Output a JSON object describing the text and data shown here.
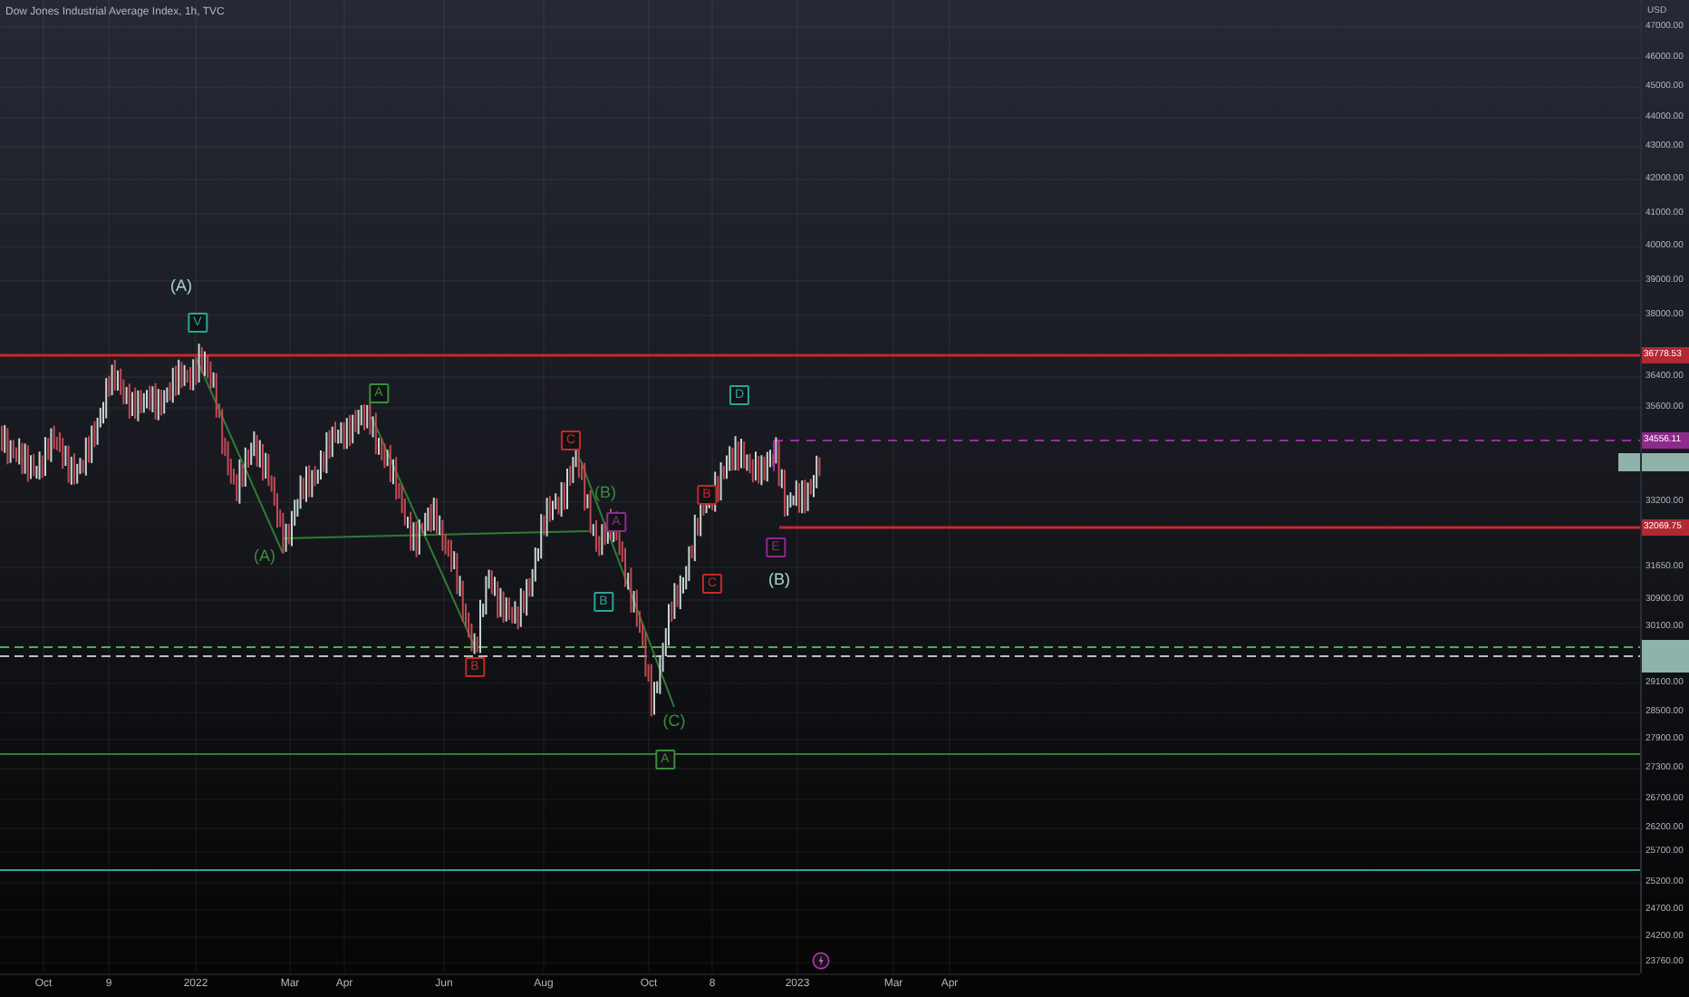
{
  "chart": {
    "title": "Dow Jones Industrial Average Index, 1h, TVC",
    "currency": "USD",
    "price_ticks": [
      "47000.00",
      "46000.00",
      "45000.00",
      "44000.00",
      "43000.00",
      "42000.00",
      "41000.00",
      "40000.00",
      "39000.00",
      "38000.00",
      "36400.00",
      "35600.00",
      "33200.00",
      "31650.00",
      "30900.00",
      "30100.00",
      "29100.00",
      "28500.00",
      "27900.00",
      "27300.00",
      "26700.00",
      "26200.00",
      "25700.00",
      "25200.00",
      "24700.00",
      "24200.00",
      "23760.00"
    ],
    "price_tags": [
      {
        "text": "36778.53",
        "color": "#b22833"
      },
      {
        "text": "34556.11",
        "color": "#8e2a8e"
      },
      {
        "text": "32069.75",
        "color": "#b22833"
      }
    ],
    "time_ticks": [
      "Oct",
      "9",
      "2022",
      "Mar",
      "Apr",
      "Jun",
      "Aug",
      "Oct",
      "8",
      "2023",
      "Mar",
      "Apr"
    ],
    "wave_labels": [
      {
        "text": "(A)",
        "kind": "plain",
        "color": "#a5d6c8"
      },
      {
        "text": "V",
        "kind": "boxed",
        "color": "#26a69a"
      },
      {
        "text": "(A)",
        "kind": "plain",
        "color": "#388e3c"
      },
      {
        "text": "A",
        "kind": "boxed",
        "color": "#388e3c"
      },
      {
        "text": "C",
        "kind": "boxed",
        "color": "#c62828"
      },
      {
        "text": "(B)",
        "kind": "plain",
        "color": "#388e3c"
      },
      {
        "text": "B",
        "kind": "boxed",
        "color": "#26a69a"
      },
      {
        "text": "A",
        "kind": "boxed",
        "color": "#8e2a8e"
      },
      {
        "text": "B",
        "kind": "boxed",
        "color": "#c62828"
      },
      {
        "text": "(C)",
        "kind": "plain",
        "color": "#388e3c"
      },
      {
        "text": "A",
        "kind": "boxed",
        "color": "#388e3c"
      },
      {
        "text": "D",
        "kind": "boxed",
        "color": "#26a69a"
      },
      {
        "text": "B",
        "kind": "boxed",
        "color": "#c62828"
      },
      {
        "text": "C",
        "kind": "boxed",
        "color": "#c62828"
      },
      {
        "text": "E",
        "kind": "boxed",
        "color": "#8e2a8e"
      },
      {
        "text": "(B)",
        "kind": "plain",
        "color": "#a5d6c8"
      }
    ]
  }
}
